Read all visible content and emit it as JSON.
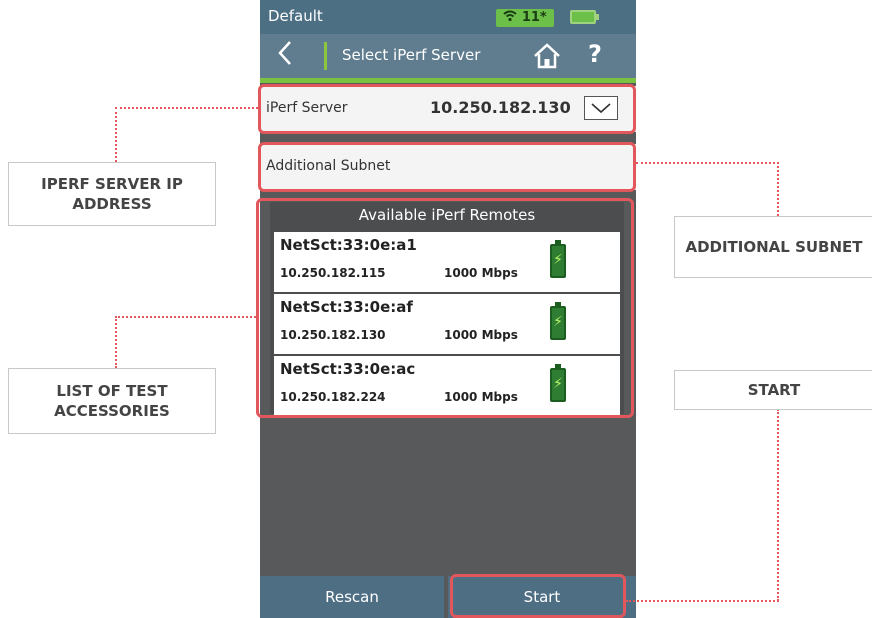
{
  "device": {
    "status_bar": {
      "profile": "Default",
      "wifi_indicator": "11*",
      "wifi_icon": "wifi-icon",
      "battery_icon": "battery-icon"
    },
    "title_bar": {
      "back_icon": "chevron-left-icon",
      "title": "Select iPerf Server",
      "home_icon": "home-icon",
      "help_label": "?"
    },
    "iperf_server": {
      "label": "iPerf Server",
      "value": "10.250.182.130",
      "dropdown_icon": "chevron-down-icon"
    },
    "additional_subnet": {
      "label": "Additional Subnet"
    },
    "remotes": {
      "header": "Available iPerf Remotes",
      "items": [
        {
          "name": "NetSct:33:0e:a1",
          "ip": "10.250.182.115",
          "speed": "1000 Mbps",
          "battery_icon": "battery-charging-icon"
        },
        {
          "name": "NetSct:33:0e:af",
          "ip": "10.250.182.130",
          "speed": "1000 Mbps",
          "battery_icon": "battery-charging-icon"
        },
        {
          "name": "NetSct:33:0e:ac",
          "ip": "10.250.182.224",
          "speed": "1000 Mbps",
          "battery_icon": "battery-charging-icon"
        }
      ]
    },
    "bottom_bar": {
      "rescan_label": "Rescan",
      "start_label": "Start"
    }
  },
  "callouts": {
    "iperf_server_ip": "IPERF SERVER IP ADDRESS",
    "additional_subnet": "ADDITIONAL SUBNET",
    "test_accessories": "LIST OF TEST ACCESSORIES",
    "start": "START"
  },
  "colors": {
    "accent_green": "#7cc242",
    "annotation_red": "#e2575c",
    "title_blue": "#5f7d8f",
    "button_blue": "#4e6e84",
    "screen_gray": "#58595b"
  }
}
